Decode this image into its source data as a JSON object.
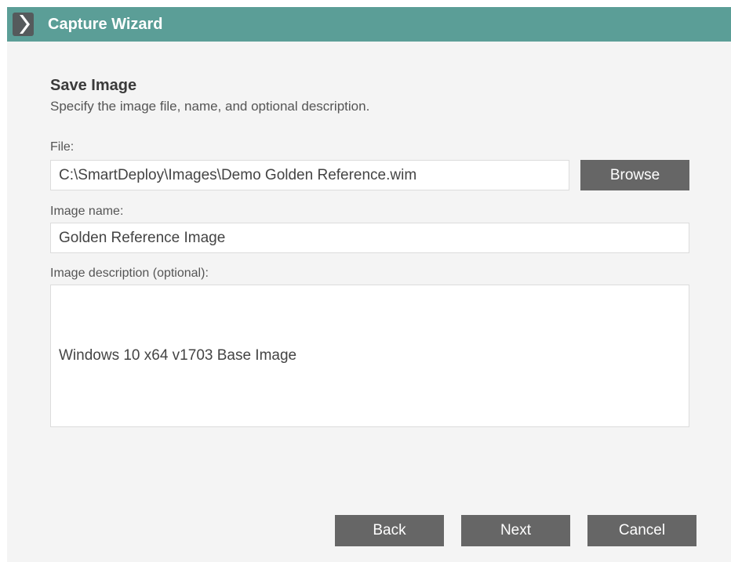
{
  "window": {
    "title": "Capture Wizard",
    "logo_icon": "chevron-right-icon"
  },
  "page": {
    "heading": "Save Image",
    "subheading": "Specify the image file, name, and optional description."
  },
  "form": {
    "file_label": "File:",
    "file_value": "C:\\SmartDeploy\\Images\\Demo Golden Reference.wim",
    "browse_label": "Browse",
    "image_name_label": "Image name:",
    "image_name_value": "Golden Reference Image",
    "image_description_label": "Image description (optional):",
    "image_description_value": "Windows 10 x64 v1703 Base Image"
  },
  "footer": {
    "back_label": "Back",
    "next_label": "Next",
    "cancel_label": "Cancel"
  },
  "colors": {
    "titlebar": "#5b9e97",
    "background": "#f4f4f4",
    "button": "#666666"
  }
}
